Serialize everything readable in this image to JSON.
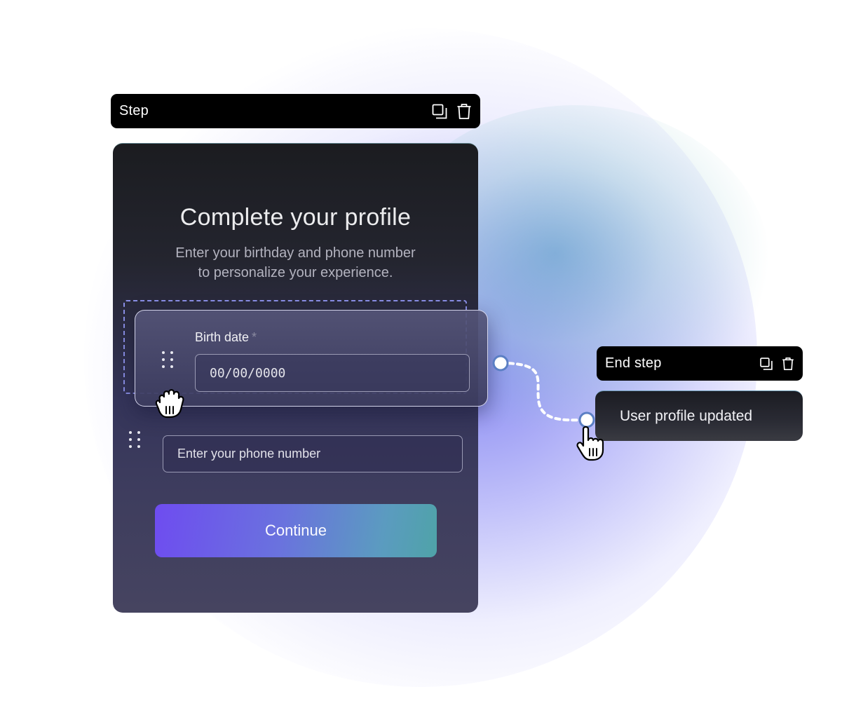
{
  "step_toolbar": {
    "title": "Step",
    "icons": [
      "duplicate-icon",
      "trash-icon"
    ]
  },
  "form": {
    "title": "Complete your profile",
    "subtitle_line1": "Enter your birthday and phone number",
    "subtitle_line2": "to personalize your experience.",
    "birth_date": {
      "label": "Birth date",
      "required_mark": "*",
      "placeholder": "00/00/0000"
    },
    "phone": {
      "placeholder": "Enter your phone number"
    },
    "continue_label": "Continue"
  },
  "end_toolbar": {
    "title": "End step",
    "icons": [
      "duplicate-icon",
      "trash-icon"
    ]
  },
  "end_card": {
    "text": "User profile updated"
  },
  "colors": {
    "accent_gradient_start": "#6e4cf0",
    "accent_gradient_end": "#4fa3a8",
    "toolbar_bg": "#000000",
    "drop_zone": "#8b90e8",
    "connector": "#ffffff"
  }
}
